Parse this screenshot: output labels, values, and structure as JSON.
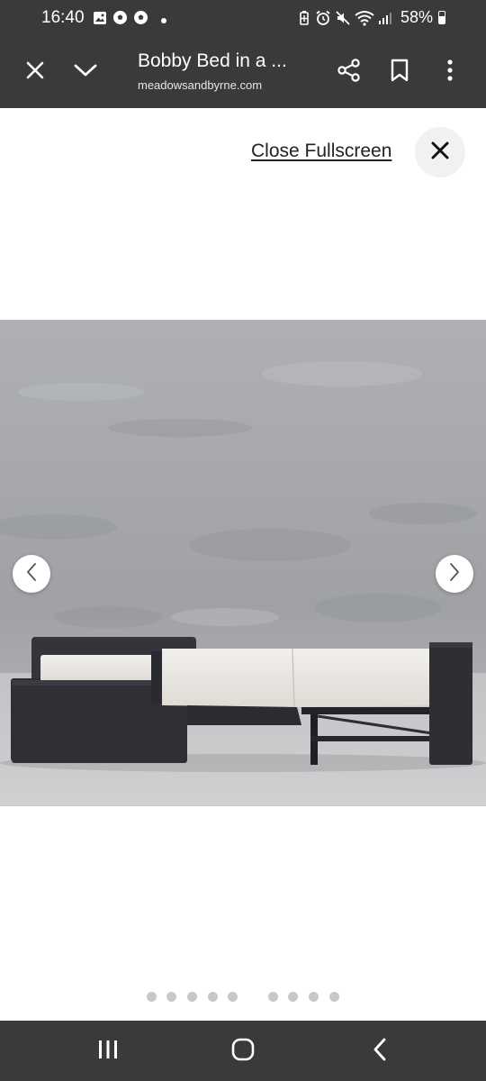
{
  "status_bar": {
    "time": "16:40",
    "battery": "58%",
    "left_icons": [
      "gallery-icon",
      "soccer-ball-icon",
      "soccer-ball-icon",
      "dot-icon"
    ],
    "right_icons": [
      "battery-saver-icon",
      "alarm-icon",
      "mute-icon",
      "wifi-icon",
      "signal-icon"
    ]
  },
  "toolbar": {
    "title": "Bobby Bed in a ...",
    "url": "meadowsandbyrne.com",
    "icons": [
      "close-icon",
      "chevron-down-icon",
      "share-icon",
      "bookmark-icon",
      "more-icon"
    ]
  },
  "fullscreen": {
    "close_label": "Close Fullscreen"
  },
  "gallery": {
    "image": "sofa-bed-unfolded",
    "dot_count": 10,
    "current_index": 0
  },
  "nav_bar": {
    "icons": [
      "recents-icon",
      "home-icon",
      "back-icon"
    ]
  },
  "colors": {
    "chrome": "#3a3a3a",
    "dot": "#c8c8c8",
    "sofa": "#2e2e35",
    "mattress": "#e9e7e2"
  }
}
